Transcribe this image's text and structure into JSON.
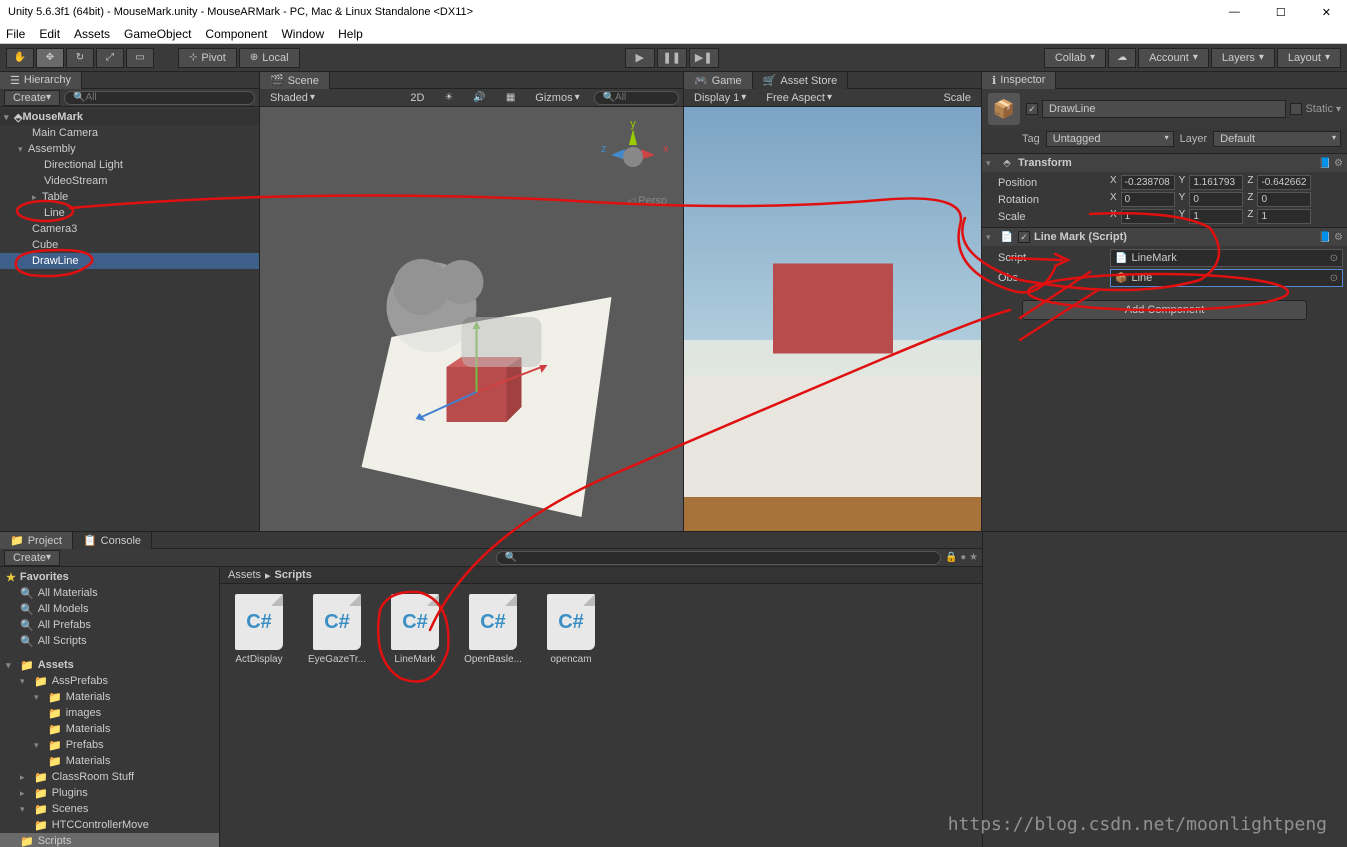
{
  "title": "Unity 5.6.3f1 (64bit) - MouseMark.unity - MouseARMark - PC, Mac & Linux Standalone <DX11>",
  "menu": [
    "File",
    "Edit",
    "Assets",
    "GameObject",
    "Component",
    "Window",
    "Help"
  ],
  "toolbar": {
    "pivot": "Pivot",
    "local": "Local",
    "collab": "Collab",
    "account": "Account",
    "layers": "Layers",
    "layout": "Layout"
  },
  "hierarchy": {
    "tab": "Hierarchy",
    "create": "Create",
    "scene": "MouseMark",
    "items": [
      "Main Camera",
      "Assembly",
      "Directional Light",
      "VideoStream",
      "Table",
      "Line",
      "Camera3",
      "Cube",
      "DrawLine"
    ]
  },
  "scene": {
    "tab": "Scene",
    "shaded": "Shaded",
    "mode2d": "2D",
    "gizmos": "Gizmos",
    "persp": "Persp"
  },
  "game": {
    "tab": "Game",
    "asset_store_tab": "Asset Store",
    "display": "Display 1",
    "aspect": "Free Aspect",
    "scale": "Scale"
  },
  "inspector": {
    "tab": "Inspector",
    "objName": "DrawLine",
    "staticLabel": "Static",
    "tagLabel": "Tag",
    "tagValue": "Untagged",
    "layerLabel": "Layer",
    "layerValue": "Default",
    "transform": {
      "name": "Transform",
      "posLabel": "Position",
      "rotLabel": "Rotation",
      "scaleLabel": "Scale",
      "pos": {
        "x": "-0.238708",
        "y": "1.161793",
        "z": "-0.642662"
      },
      "rot": {
        "x": "0",
        "y": "0",
        "z": "0"
      },
      "scale": {
        "x": "1",
        "y": "1",
        "z": "1"
      }
    },
    "script": {
      "name": "Line Mark (Script)",
      "scriptLabel": "Script",
      "scriptValue": "LineMark",
      "obsLabel": "Obs",
      "obsValue": "Line"
    },
    "addComponent": "Add Component"
  },
  "project": {
    "tab": "Project",
    "console_tab": "Console",
    "create": "Create",
    "favorites": "Favorites",
    "fav_items": [
      "All Materials",
      "All Models",
      "All Prefabs",
      "All Scripts"
    ],
    "assets_root": "Assets",
    "folders": [
      "AssPrefabs",
      "Materials",
      "images",
      "Materials",
      "Prefabs",
      "Materials",
      "ClassRoom Stuff",
      "Plugins",
      "Scenes",
      "HTCControllerMove",
      "Scripts"
    ],
    "breadcrumb_assets": "Assets",
    "breadcrumb_scripts": "Scripts",
    "files": [
      "ActDisplay",
      "EyeGazeTr...",
      "LineMark",
      "OpenBasle...",
      "opencam"
    ]
  },
  "watermark": "https://blog.csdn.net/moonlightpeng"
}
